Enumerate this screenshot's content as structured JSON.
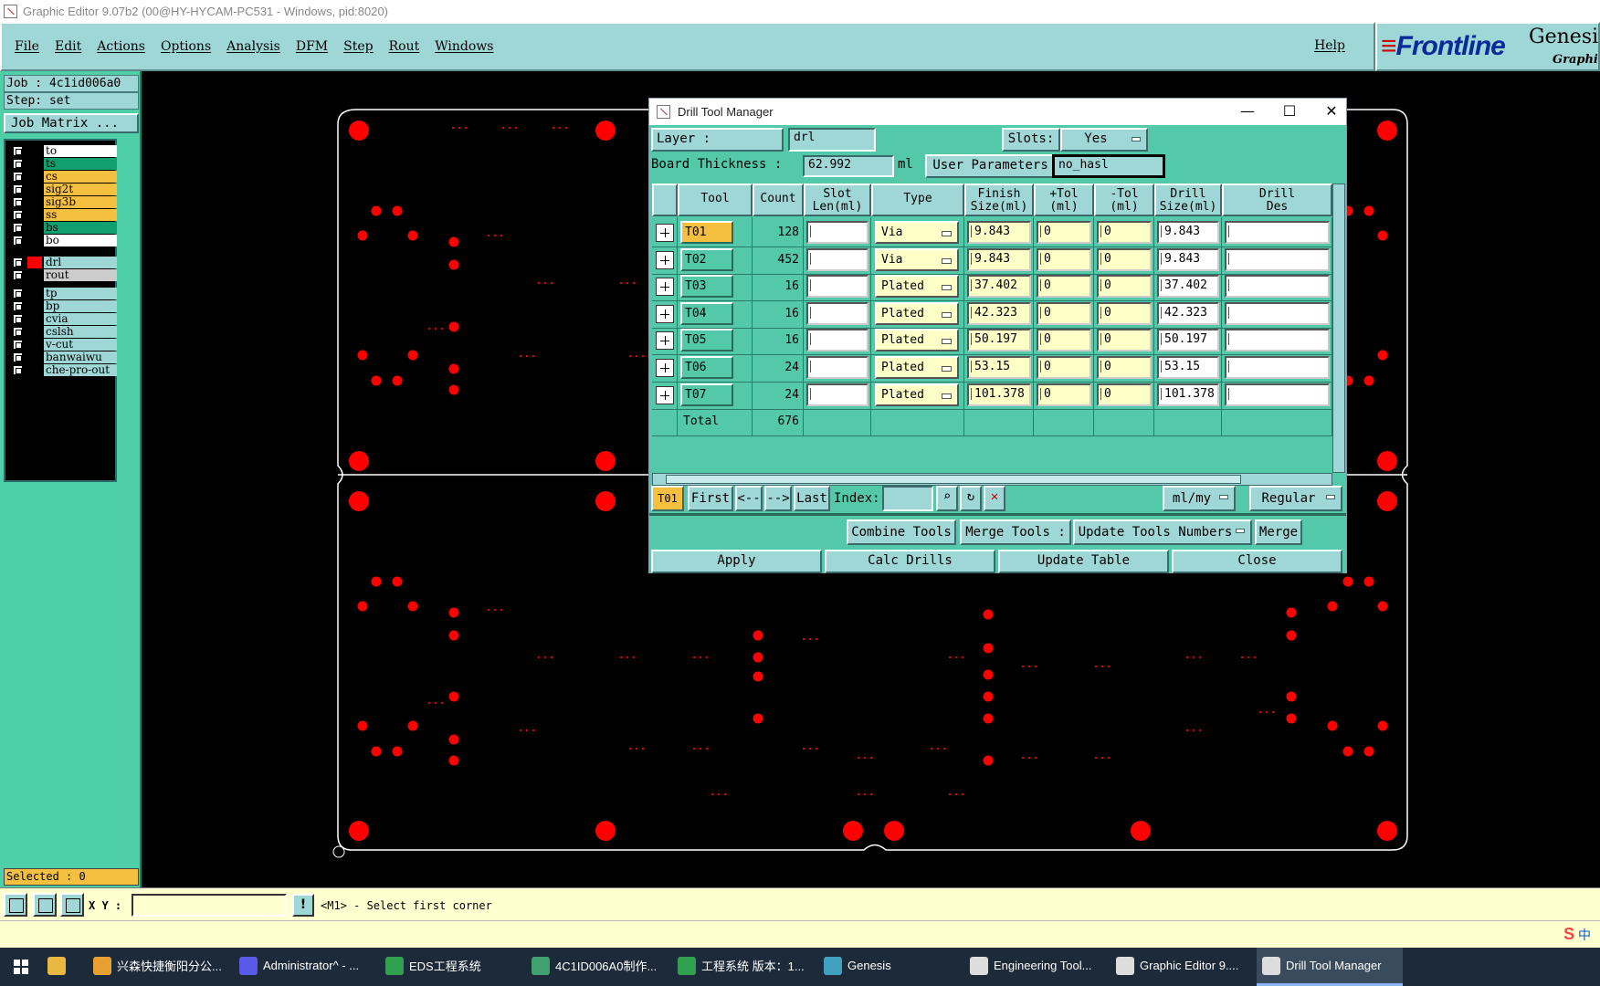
{
  "window": {
    "title": "Graphic Editor 9.07b2 (00@HY-HYCAM-PC531 - Windows, pid:8020)"
  },
  "menu": {
    "items": [
      "File",
      "Edit",
      "Actions",
      "Options",
      "Analysis",
      "DFM",
      "Step",
      "Rout",
      "Windows"
    ],
    "help": "Help"
  },
  "brand": {
    "logo": "Frontline",
    "product": "Genesis",
    "subtitle": "Graphic"
  },
  "left": {
    "job": "Job  : 4c1id006a0",
    "step": "Step: set",
    "job_matrix": "Job Matrix ...",
    "selected": "Selected : 0",
    "layers": [
      {
        "name": "to",
        "color": "#ffffff",
        "swatch": "#000000"
      },
      {
        "name": "ts",
        "color": "#10a070",
        "swatch": "#000000"
      },
      {
        "name": "cs",
        "color": "#f5c040",
        "swatch": "#000000"
      },
      {
        "name": "sig2t",
        "color": "#f5c040",
        "swatch": "#000000"
      },
      {
        "name": "sig3b",
        "color": "#f5c040",
        "swatch": "#000000"
      },
      {
        "name": "ss",
        "color": "#f5c040",
        "swatch": "#000000"
      },
      {
        "name": "bs",
        "color": "#10a070",
        "swatch": "#000000"
      },
      {
        "name": "bo",
        "color": "#ffffff",
        "swatch": "#000000"
      },
      {
        "name": "drl",
        "color": "#9fd7d7",
        "swatch": "#ff0000"
      },
      {
        "name": "rout",
        "color": "#cccccc",
        "swatch": "#000000"
      },
      {
        "name": "tp",
        "color": "#9fd7d7",
        "swatch": "#000000"
      },
      {
        "name": "bp",
        "color": "#9fd7d7",
        "swatch": "#000000"
      },
      {
        "name": "cvia",
        "color": "#9fd7d7",
        "swatch": "#000000"
      },
      {
        "name": "cslsh",
        "color": "#9fd7d7",
        "swatch": "#000000"
      },
      {
        "name": "v-cut",
        "color": "#9fd7d7",
        "swatch": "#000000"
      },
      {
        "name": "banwaiwu",
        "color": "#9fd7d7",
        "swatch": "#000000"
      },
      {
        "name": "che-pro-out",
        "color": "#9fd7d7",
        "swatch": "#000000"
      }
    ]
  },
  "status": {
    "xy_label": "X Y :",
    "prompt": "<M1> - Select first corner"
  },
  "ime": {
    "label": "中"
  },
  "taskbar": {
    "items": [
      {
        "label": "兴森快捷衡阳分公...",
        "color": "#e8a030"
      },
      {
        "label": "Administrator^ - ...",
        "color": "#5a5ae8"
      },
      {
        "label": "EDS工程系统",
        "color": "#30a050"
      },
      {
        "label": "4C1ID006A0制作...",
        "color": "#40a070"
      },
      {
        "label": "工程系统  版本：1...",
        "color": "#30a050"
      },
      {
        "label": "Genesis",
        "color": "#40a0c0"
      },
      {
        "label": "Engineering Tool...",
        "color": "#dddddd"
      },
      {
        "label": "Graphic Editor 9....",
        "color": "#dddddd"
      },
      {
        "label": "Drill Tool Manager",
        "color": "#dddddd"
      }
    ]
  },
  "dialog": {
    "title": "Drill Tool Manager",
    "layer_label": "Layer         :",
    "layer_value": "drl",
    "slots_label": "Slots:",
    "slots_value": "Yes",
    "board_thickness_label": "Board Thickness :",
    "board_thickness_value": "62.992",
    "board_thickness_unit": "ml",
    "user_params_label": "User Parameters :",
    "user_params_value": "no_hasl",
    "columns": [
      "Tool",
      "Count",
      "Slot\nLen(ml)",
      "Type",
      "Finish\nSize(ml)",
      "+Tol\n(ml)",
      "-Tol\n(ml)",
      "Drill\nSize(ml)",
      "Drill\nDes"
    ],
    "rows": [
      {
        "tool": "T01",
        "count": "128",
        "type": "Via",
        "finish": "9.843",
        "ptol": "0",
        "ntol": "0",
        "drill": "9.843"
      },
      {
        "tool": "T02",
        "count": "452",
        "type": "Via",
        "finish": "9.843",
        "ptol": "0",
        "ntol": "0",
        "drill": "9.843"
      },
      {
        "tool": "T03",
        "count": "16",
        "type": "Plated",
        "finish": "37.402",
        "ptol": "0",
        "ntol": "0",
        "drill": "37.402"
      },
      {
        "tool": "T04",
        "count": "16",
        "type": "Plated",
        "finish": "42.323",
        "ptol": "0",
        "ntol": "0",
        "drill": "42.323"
      },
      {
        "tool": "T05",
        "count": "16",
        "type": "Plated",
        "finish": "50.197",
        "ptol": "0",
        "ntol": "0",
        "drill": "50.197"
      },
      {
        "tool": "T06",
        "count": "24",
        "type": "Plated",
        "finish": "53.15",
        "ptol": "0",
        "ntol": "0",
        "drill": "53.15"
      },
      {
        "tool": "T07",
        "count": "24",
        "type": "Plated",
        "finish": "101.378",
        "ptol": "0",
        "ntol": "0",
        "drill": "101.378"
      }
    ],
    "total_label": "Total",
    "total_count": "676",
    "current_tool": "T01",
    "nav": {
      "first": "First",
      "prev": "<--",
      "next": "-->",
      "last": "Last",
      "index_label": "Index:"
    },
    "units": "ml/my",
    "mode": "Regular",
    "combine_tools": "Combine Tools",
    "merge_tools_label": "Merge Tools :",
    "update_numbers": "Update Tools Numbers",
    "merge": "Merge",
    "apply": "Apply",
    "calc_drills": "Calc Drills",
    "update_table": "Update Table",
    "close": "Close"
  }
}
